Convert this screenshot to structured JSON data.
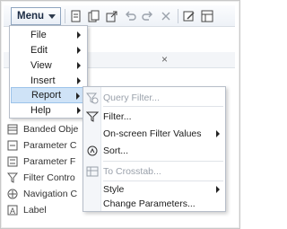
{
  "toolbar": {
    "menu_label": "Menu",
    "icons": [
      "export-icon",
      "duplicate-icon",
      "share-icon",
      "undo-icon",
      "redo-icon",
      "close-icon",
      "edit-icon",
      "properties-icon"
    ]
  },
  "background": {
    "close_glyph": "×",
    "tree": [
      {
        "label": "Banded Obje",
        "icon": "banded-object-icon"
      },
      {
        "label": "Parameter C",
        "icon": "parameter-icon"
      },
      {
        "label": "Parameter F",
        "icon": "parameter-form-icon"
      },
      {
        "label": "Filter Contro",
        "icon": "filter-control-icon"
      },
      {
        "label": "Navigation C",
        "icon": "navigation-icon"
      },
      {
        "label": "Label",
        "icon": "label-icon"
      }
    ]
  },
  "main_menu": {
    "items": [
      {
        "label": "File",
        "has_submenu": true
      },
      {
        "label": "Edit",
        "has_submenu": true
      },
      {
        "label": "View",
        "has_submenu": true
      },
      {
        "label": "Insert",
        "has_submenu": true
      },
      {
        "label": "Report",
        "has_submenu": true,
        "active": true
      },
      {
        "label": "Help",
        "has_submenu": true
      }
    ]
  },
  "report_submenu": {
    "items": [
      {
        "label": "Query Filter...",
        "enabled": false,
        "icon": "query-filter-icon"
      },
      {
        "label": "Filter...",
        "enabled": true,
        "icon": "filter-icon"
      },
      {
        "label": "On-screen Filter Values",
        "enabled": true,
        "has_submenu": true
      },
      {
        "label": "Sort...",
        "enabled": true,
        "icon": "sort-icon"
      },
      {
        "label": "To Crosstab...",
        "enabled": false,
        "icon": "crosstab-icon"
      },
      {
        "label": "Style",
        "enabled": true,
        "has_submenu": true
      },
      {
        "label": "Change Parameters...",
        "enabled": true
      }
    ]
  },
  "colors": {
    "highlight": "#cfe3f7",
    "disabled_text": "#9aa1ab",
    "menu_border": "#b7bec9"
  }
}
